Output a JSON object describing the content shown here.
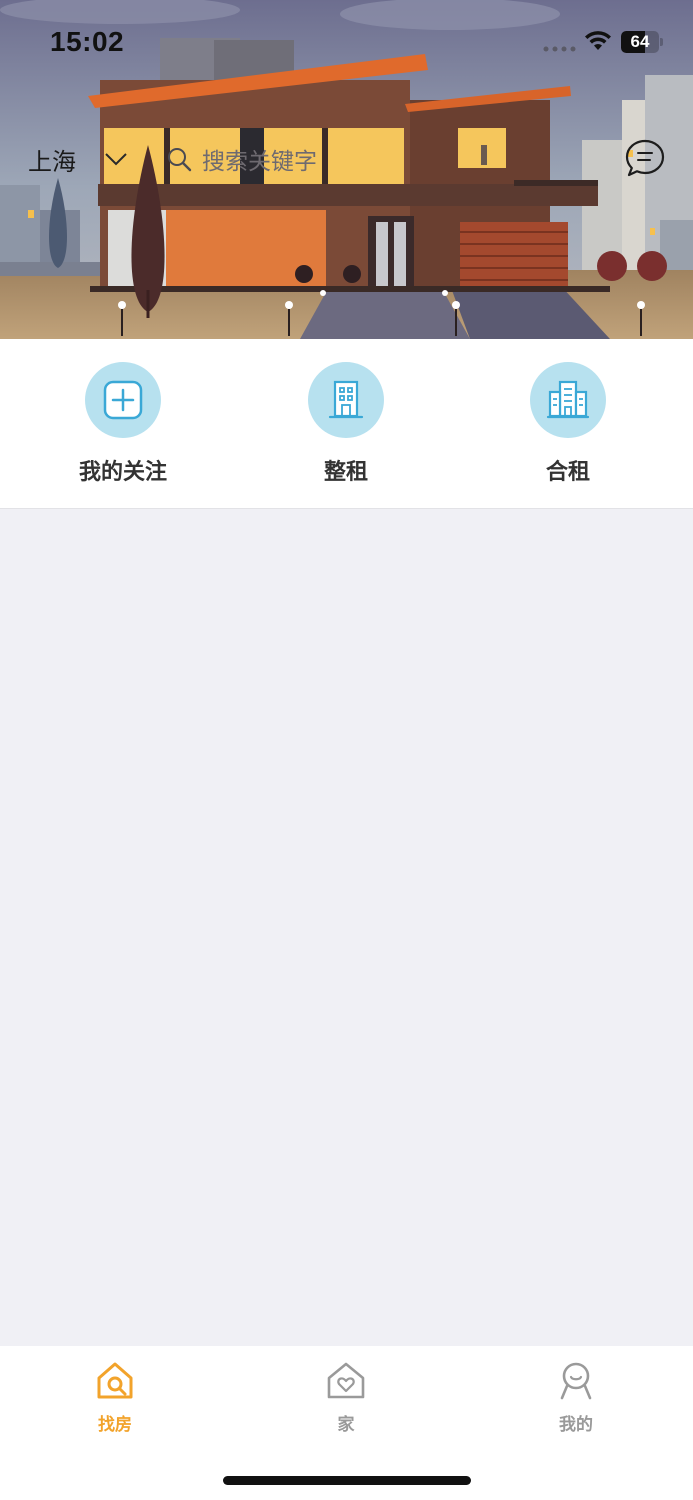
{
  "status_bar": {
    "time": "15:02",
    "battery_level": "64",
    "battery_percent": 64
  },
  "header": {
    "city": "上海",
    "search_placeholder": "搜索关键字",
    "icons": {
      "city_dropdown": "chevron-down-icon",
      "search": "search-icon",
      "message": "message-icon"
    }
  },
  "quick_nav": [
    {
      "label": "我的关注",
      "icon": "add-square-icon"
    },
    {
      "label": "整租",
      "icon": "building-icon"
    },
    {
      "label": "合租",
      "icon": "buildings-icon"
    }
  ],
  "tab_bar": {
    "active_color": "#f2a32b",
    "inactive_color": "#9a9a9a",
    "tabs": [
      {
        "label": "找房",
        "icon": "find-house-icon",
        "active": true
      },
      {
        "label": "家",
        "icon": "home-heart-icon",
        "active": false
      },
      {
        "label": "我的",
        "icon": "profile-icon",
        "active": false
      }
    ]
  }
}
